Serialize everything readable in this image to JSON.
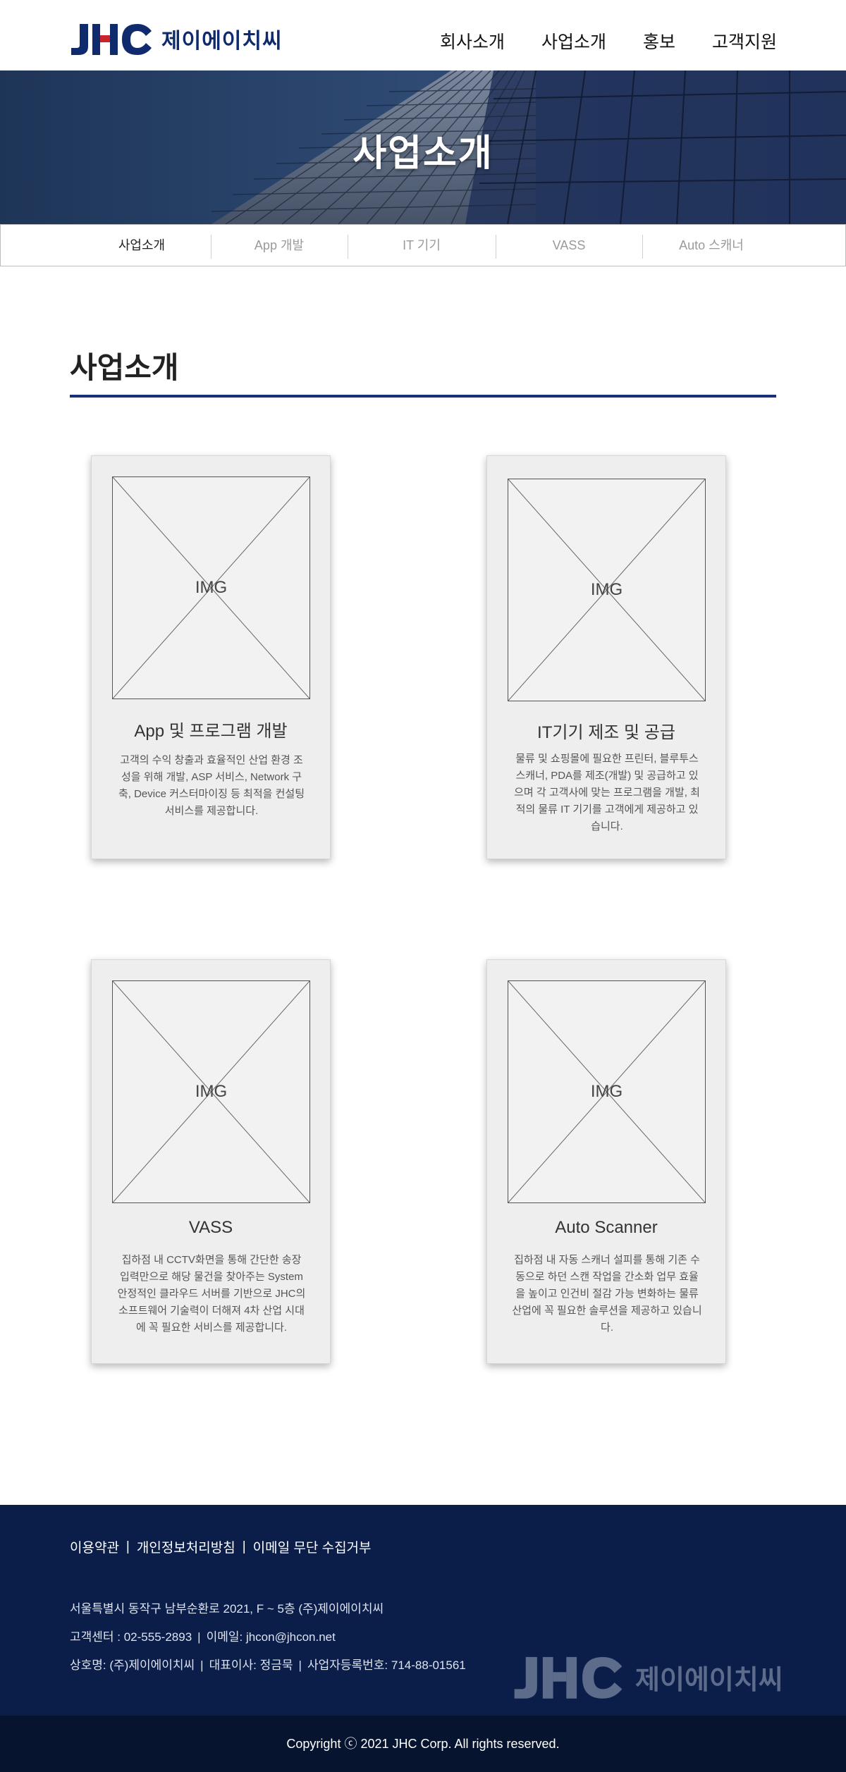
{
  "header": {
    "logo_mark": "JHC",
    "logo_text": "제이에이치씨",
    "nav": [
      "회사소개",
      "사업소개",
      "홍보",
      "고객지원"
    ]
  },
  "hero": {
    "title": "사업소개"
  },
  "subnav": {
    "items": [
      "사업소개",
      "App 개발",
      "IT 기기",
      "VASS",
      "Auto 스캐너"
    ],
    "active_index": 0
  },
  "section": {
    "title": "사업소개"
  },
  "cards": [
    {
      "img_label": "IMG",
      "title": "App 및 프로그램 개발",
      "desc": "고객의 수익 창출과 효율적인 산업 환경 조성을 위해 개발, ASP 서비스, Network 구축, Device 커스터마이징 등 최적을 컨설팅 서비스를 제공합니다."
    },
    {
      "img_label": "IMG",
      "title": "IT기기 제조 및 공급",
      "desc": "물류 및 쇼핑몰에 필요한 프린터, 블루투스 스캐너, PDA를 제조(개발) 및 공급하고 있으며 각 고객사에 맞는 프로그램을 개발, 최적의 물류 IT 기기를 고객에게 제공하고 있습니다."
    },
    {
      "img_label": "IMG",
      "title": "VASS",
      "desc": "집하점 내 CCTV화면을 통해 간단한 송장 입력만으로 해당 물건을 찾아주는 System 안정적인 클라우드 서버를 기반으로 JHC의 소프트웨어 기술력이 더해져 4차 산업 시대에 꼭 필요한 서비스를 제공합니다."
    },
    {
      "img_label": "IMG",
      "title": "Auto Scanner",
      "desc": "집하점 내 자동 스캐너 설피를 통해 기존 수동으로 하던 스캔 작업을 간소화 업무 효율을 높이고 인건비 절감 가능 변화하는 물류산업에 꼭 필요한 솔루션을 제공하고 있습니다."
    }
  ],
  "footer": {
    "links": [
      "이용약관",
      "개인정보처리방침",
      "이메일 무단 수집거부"
    ],
    "address": "서울특별시 동작구 남부순환로 2021, F ~ 5층 (주)제이에이치씨",
    "service_center": "고객센터 : 02-555-2893",
    "email": "이메일: jhcon@jhcon.net",
    "company_name": "상호명: (주)제이에이치씨",
    "ceo": "대표이사: 정금묵",
    "biz_number": "사업자등록번호: 714-88-01561",
    "logo_mark": "JHC",
    "logo_text": "제이에이치씨",
    "copyright": "Copyright ⓒ 2021 JHC Corp. All rights reserved."
  },
  "colors": {
    "brand_navy": "#0f2b6e",
    "section_rule": "#1a2f7a",
    "footer_bg": "#0b1e4a",
    "copyright_bg": "#07142f"
  }
}
